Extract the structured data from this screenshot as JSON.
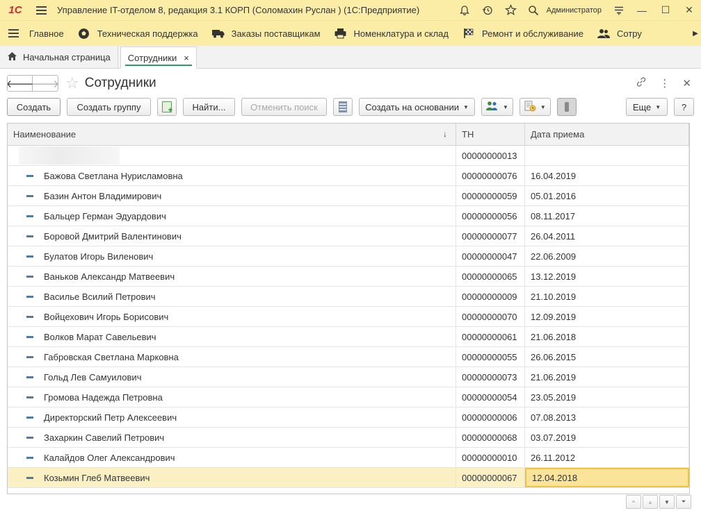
{
  "app": {
    "logo": "1С",
    "title": "Управление IT-отделом 8, редакция 3.1 КОРП (Соломахин Руслан )  (1С:Предприятие)",
    "user": "Администратор"
  },
  "sections": [
    {
      "label": "Главное",
      "icon": "hamburger-icon"
    },
    {
      "label": "Техническая поддержка",
      "icon": "soccer-ball-icon"
    },
    {
      "label": "Заказы поставщикам",
      "icon": "truck-icon"
    },
    {
      "label": "Номенклатура и склад",
      "icon": "printer-icon"
    },
    {
      "label": "Ремонт и обслуживание",
      "icon": "checkered-flag-icon"
    },
    {
      "label": "Сотру",
      "icon": "people-icon"
    }
  ],
  "tabs": {
    "home": "Начальная страница",
    "active": "Сотрудники",
    "close": "×"
  },
  "form": {
    "title": "Сотрудники"
  },
  "toolbar": {
    "create": "Создать",
    "create_group": "Создать группу",
    "find": "Найти...",
    "cancel_search": "Отменить поиск",
    "create_based_on": "Создать на основании",
    "more": "Еще",
    "help": "?"
  },
  "table": {
    "columns": {
      "name": "Наименование",
      "tn": "ТН",
      "hire_date": "Дата приема"
    },
    "sort_indicator": "↓",
    "first_row": {
      "name": "",
      "tn": "00000000013",
      "date": ""
    },
    "rows": [
      {
        "name": "Бажова Светлана Нурисламовна",
        "tn": "00000000076",
        "date": "16.04.2019"
      },
      {
        "name": "Базин Антон Владимирович",
        "tn": "00000000059",
        "date": "05.01.2016"
      },
      {
        "name": "Бальцер Герман Эдуардович",
        "tn": "00000000056",
        "date": "08.11.2017"
      },
      {
        "name": "Боровой Дмитрий Валентинович",
        "tn": "00000000077",
        "date": "26.04.2011"
      },
      {
        "name": "Булатов Игорь Виленович",
        "tn": "00000000047",
        "date": "22.06.2009"
      },
      {
        "name": "Ваньков Александр Матвеевич",
        "tn": "00000000065",
        "date": "13.12.2019"
      },
      {
        "name": "Василье Всилий Петрович",
        "tn": "00000000009",
        "date": "21.10.2019"
      },
      {
        "name": "Войцехович Игорь Борисович",
        "tn": "00000000070",
        "date": "12.09.2019"
      },
      {
        "name": "Волков Марат Савельевич",
        "tn": "00000000061",
        "date": "21.06.2018"
      },
      {
        "name": "Габровская Светлана Марковна",
        "tn": "00000000055",
        "date": "26.06.2015"
      },
      {
        "name": "Гольд Лев Самуилович",
        "tn": "00000000073",
        "date": "21.06.2019"
      },
      {
        "name": "Громова Надежда Петровна",
        "tn": "00000000054",
        "date": "23.05.2019"
      },
      {
        "name": "Директорский Петр Алексеевич",
        "tn": "00000000006",
        "date": "07.08.2013"
      },
      {
        "name": "Захаркин Савелий Петрович",
        "tn": "00000000068",
        "date": "03.07.2019"
      },
      {
        "name": "Калайдов Олег Александрович",
        "tn": "00000000010",
        "date": "26.11.2012"
      },
      {
        "name": "Козьмин Глеб Матвеевич",
        "tn": "00000000067",
        "date": "12.04.2018",
        "selected": true
      }
    ]
  }
}
